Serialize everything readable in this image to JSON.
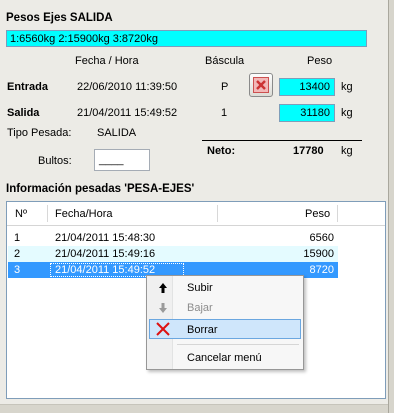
{
  "title": "Pesos Ejes SALIDA",
  "axles_summary": "1:6560kg 2:15900kg 3:8720kg",
  "headers": {
    "fecha_hora": "Fecha / Hora",
    "bascula": "Báscula",
    "peso": "Peso"
  },
  "entrada": {
    "label": "Entrada",
    "datetime": "22/06/2010 11:39:50",
    "bascula": "P",
    "peso": "13400",
    "unit": "kg"
  },
  "salida": {
    "label": "Salida",
    "datetime": "21/04/2011 15:49:52",
    "bascula": "1",
    "peso": "31180",
    "unit": "kg"
  },
  "tipo_pesada": {
    "label": "Tipo Pesada:",
    "value": "SALIDA"
  },
  "bultos": {
    "label": "Bultos:",
    "value": "____"
  },
  "neto": {
    "label": "Neto:",
    "value": "17780",
    "unit": "kg"
  },
  "grid": {
    "title": "Información pesadas 'PESA-EJES'",
    "columns": [
      "Nº",
      "Fecha/Hora",
      "Peso"
    ],
    "rows": [
      {
        "n": "1",
        "fecha": "21/04/2011 15:48:30",
        "peso": "6560"
      },
      {
        "n": "2",
        "fecha": "21/04/2011 15:49:16",
        "peso": "15900"
      },
      {
        "n": "3",
        "fecha": "21/04/2011 15:49:52",
        "peso": "8720"
      }
    ]
  },
  "context_menu": {
    "items": [
      {
        "label": "Subir",
        "icon": "arrow-up-icon",
        "enabled": true
      },
      {
        "label": "Bajar",
        "icon": "arrow-down-icon",
        "enabled": false
      },
      {
        "label": "Borrar",
        "icon": "red-x-icon",
        "enabled": true,
        "highlighted": true
      },
      {
        "label": "Cancelar menú",
        "icon": "",
        "enabled": true
      }
    ]
  },
  "colors": {
    "field_cyan": "#00ffff",
    "selection": "#3399ff",
    "delete_red": "#cc3333"
  }
}
